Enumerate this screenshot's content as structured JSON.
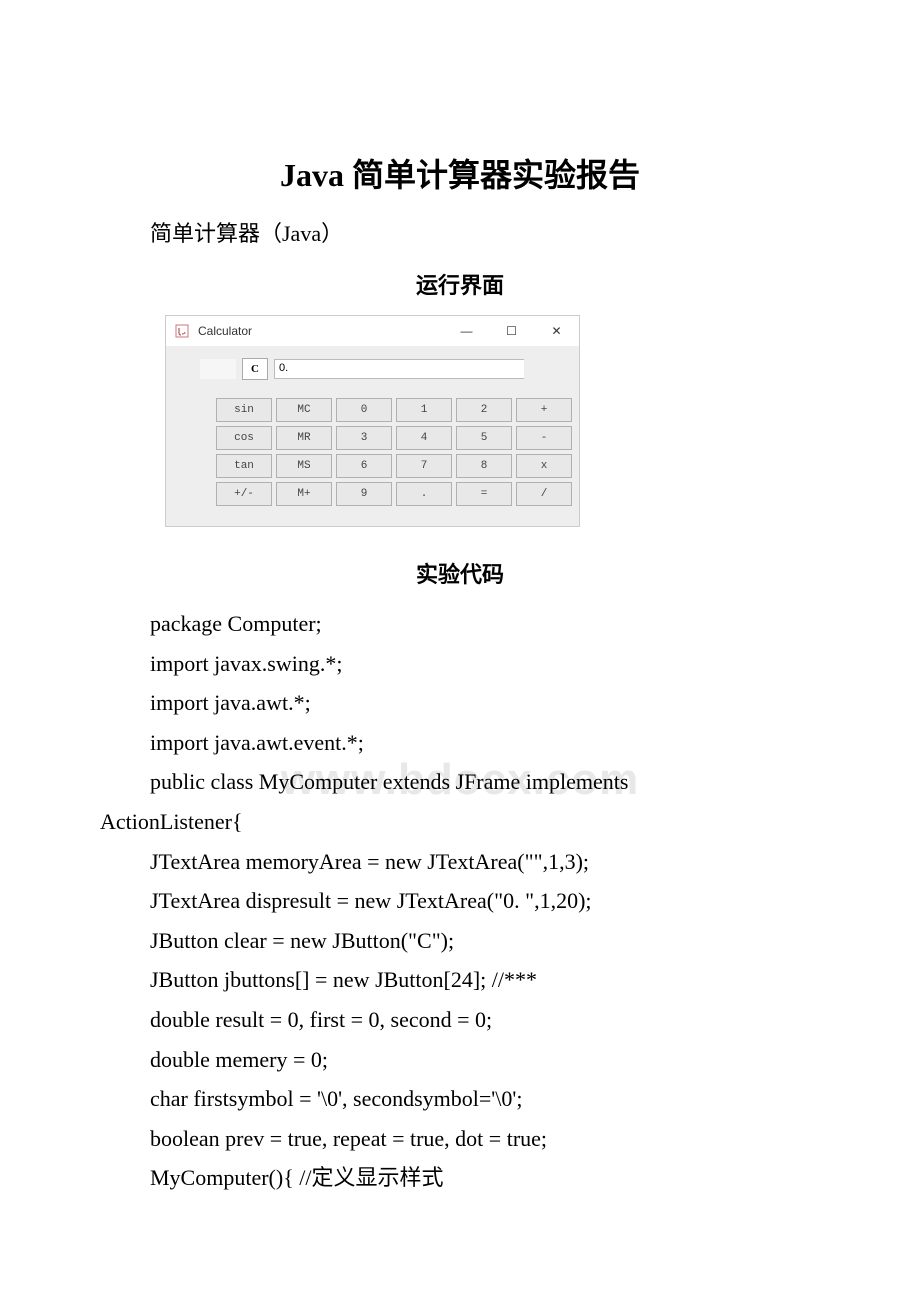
{
  "title": "Java 简单计算器实验报告",
  "subtitle": "简单计算器（Java）",
  "section_run": "运行界面",
  "section_code": "实验代码",
  "watermark": "www.bdocx.com",
  "calc": {
    "title": "Calculator",
    "display_value": "0.",
    "clear_label": "C",
    "win_min": "—",
    "win_max": "☐",
    "win_close": "✕",
    "buttons": [
      "sin",
      "MC",
      "0",
      "1",
      "2",
      "+",
      "cos",
      "MR",
      "3",
      "4",
      "5",
      "-",
      "tan",
      "MS",
      "6",
      "7",
      "8",
      "x",
      "+/-",
      "M+",
      "9",
      ".",
      "=",
      "/"
    ]
  },
  "code": {
    "l1": "package Computer;",
    "l2": "import javax.swing.*;",
    "l3": "import java.awt.*;",
    "l4": "import java.awt.event.*;",
    "l5a": "public class MyComputer extends JFrame implements",
    "l5b": "ActionListener{",
    "l6": "JTextArea memoryArea = new JTextArea(\"\",1,3);",
    "l7": "JTextArea dispresult = new JTextArea(\"0. \",1,20);",
    "l8": "JButton clear = new JButton(\"C\");",
    "l9": "JButton jbuttons[] = new JButton[24]; //***",
    "l10": "double result = 0, first = 0, second = 0;",
    "l11": "double memery = 0;",
    "l12": "char firstsymbol = '\\0', secondsymbol='\\0';",
    "l13": "boolean prev = true, repeat = true, dot = true;",
    "l14": "MyComputer(){ //定义显示样式"
  }
}
